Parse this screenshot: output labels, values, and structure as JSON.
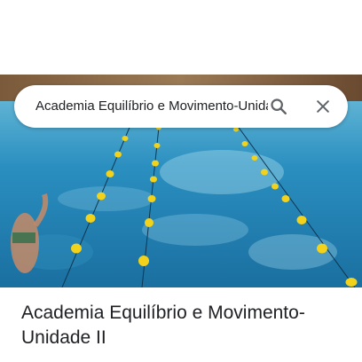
{
  "search": {
    "query": "Academia Equilíbrio e Movimento-Unidade II",
    "search_icon": "search-icon",
    "close_icon": "close-icon"
  },
  "hero": {
    "alt_subject": "swimming-pool-photo"
  },
  "place": {
    "title": "Academia Equilíbrio e Movimento-Unidade II"
  },
  "colors": {
    "icon": "#5f6368",
    "water": "#1f7fb0",
    "buoy": "#f2d21a",
    "text": "#202124"
  }
}
